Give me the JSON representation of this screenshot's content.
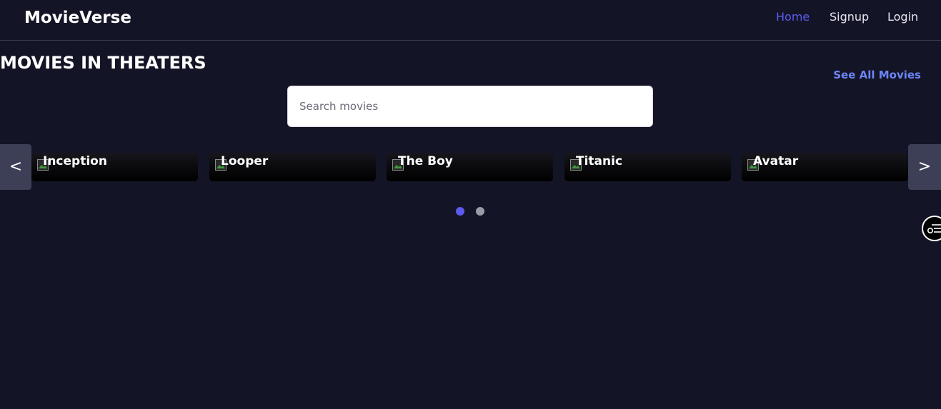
{
  "header": {
    "brand": "MovieVerse",
    "nav": [
      {
        "label": "Home",
        "active": true
      },
      {
        "label": "Signup",
        "active": false
      },
      {
        "label": "Login",
        "active": false
      }
    ]
  },
  "section": {
    "title": "MOVIES IN THEATERS",
    "see_all": "See All Movies"
  },
  "search": {
    "placeholder": "Search movies",
    "value": ""
  },
  "carousel": {
    "prev_label": "<",
    "next_label": ">",
    "movies": [
      "Inception",
      "Looper",
      "The Boy",
      "Titanic",
      "Avatar"
    ],
    "page_count": 2,
    "active_page": 1
  },
  "colors": {
    "background": "#141427",
    "accent": "#5b5bf0",
    "link": "#6b86f5",
    "dot_active": "#5b5bf0",
    "dot_inactive": "#9a9aa8"
  },
  "icons": {
    "broken_image": "broken-image-icon",
    "fab": "playlist-settings-icon"
  }
}
